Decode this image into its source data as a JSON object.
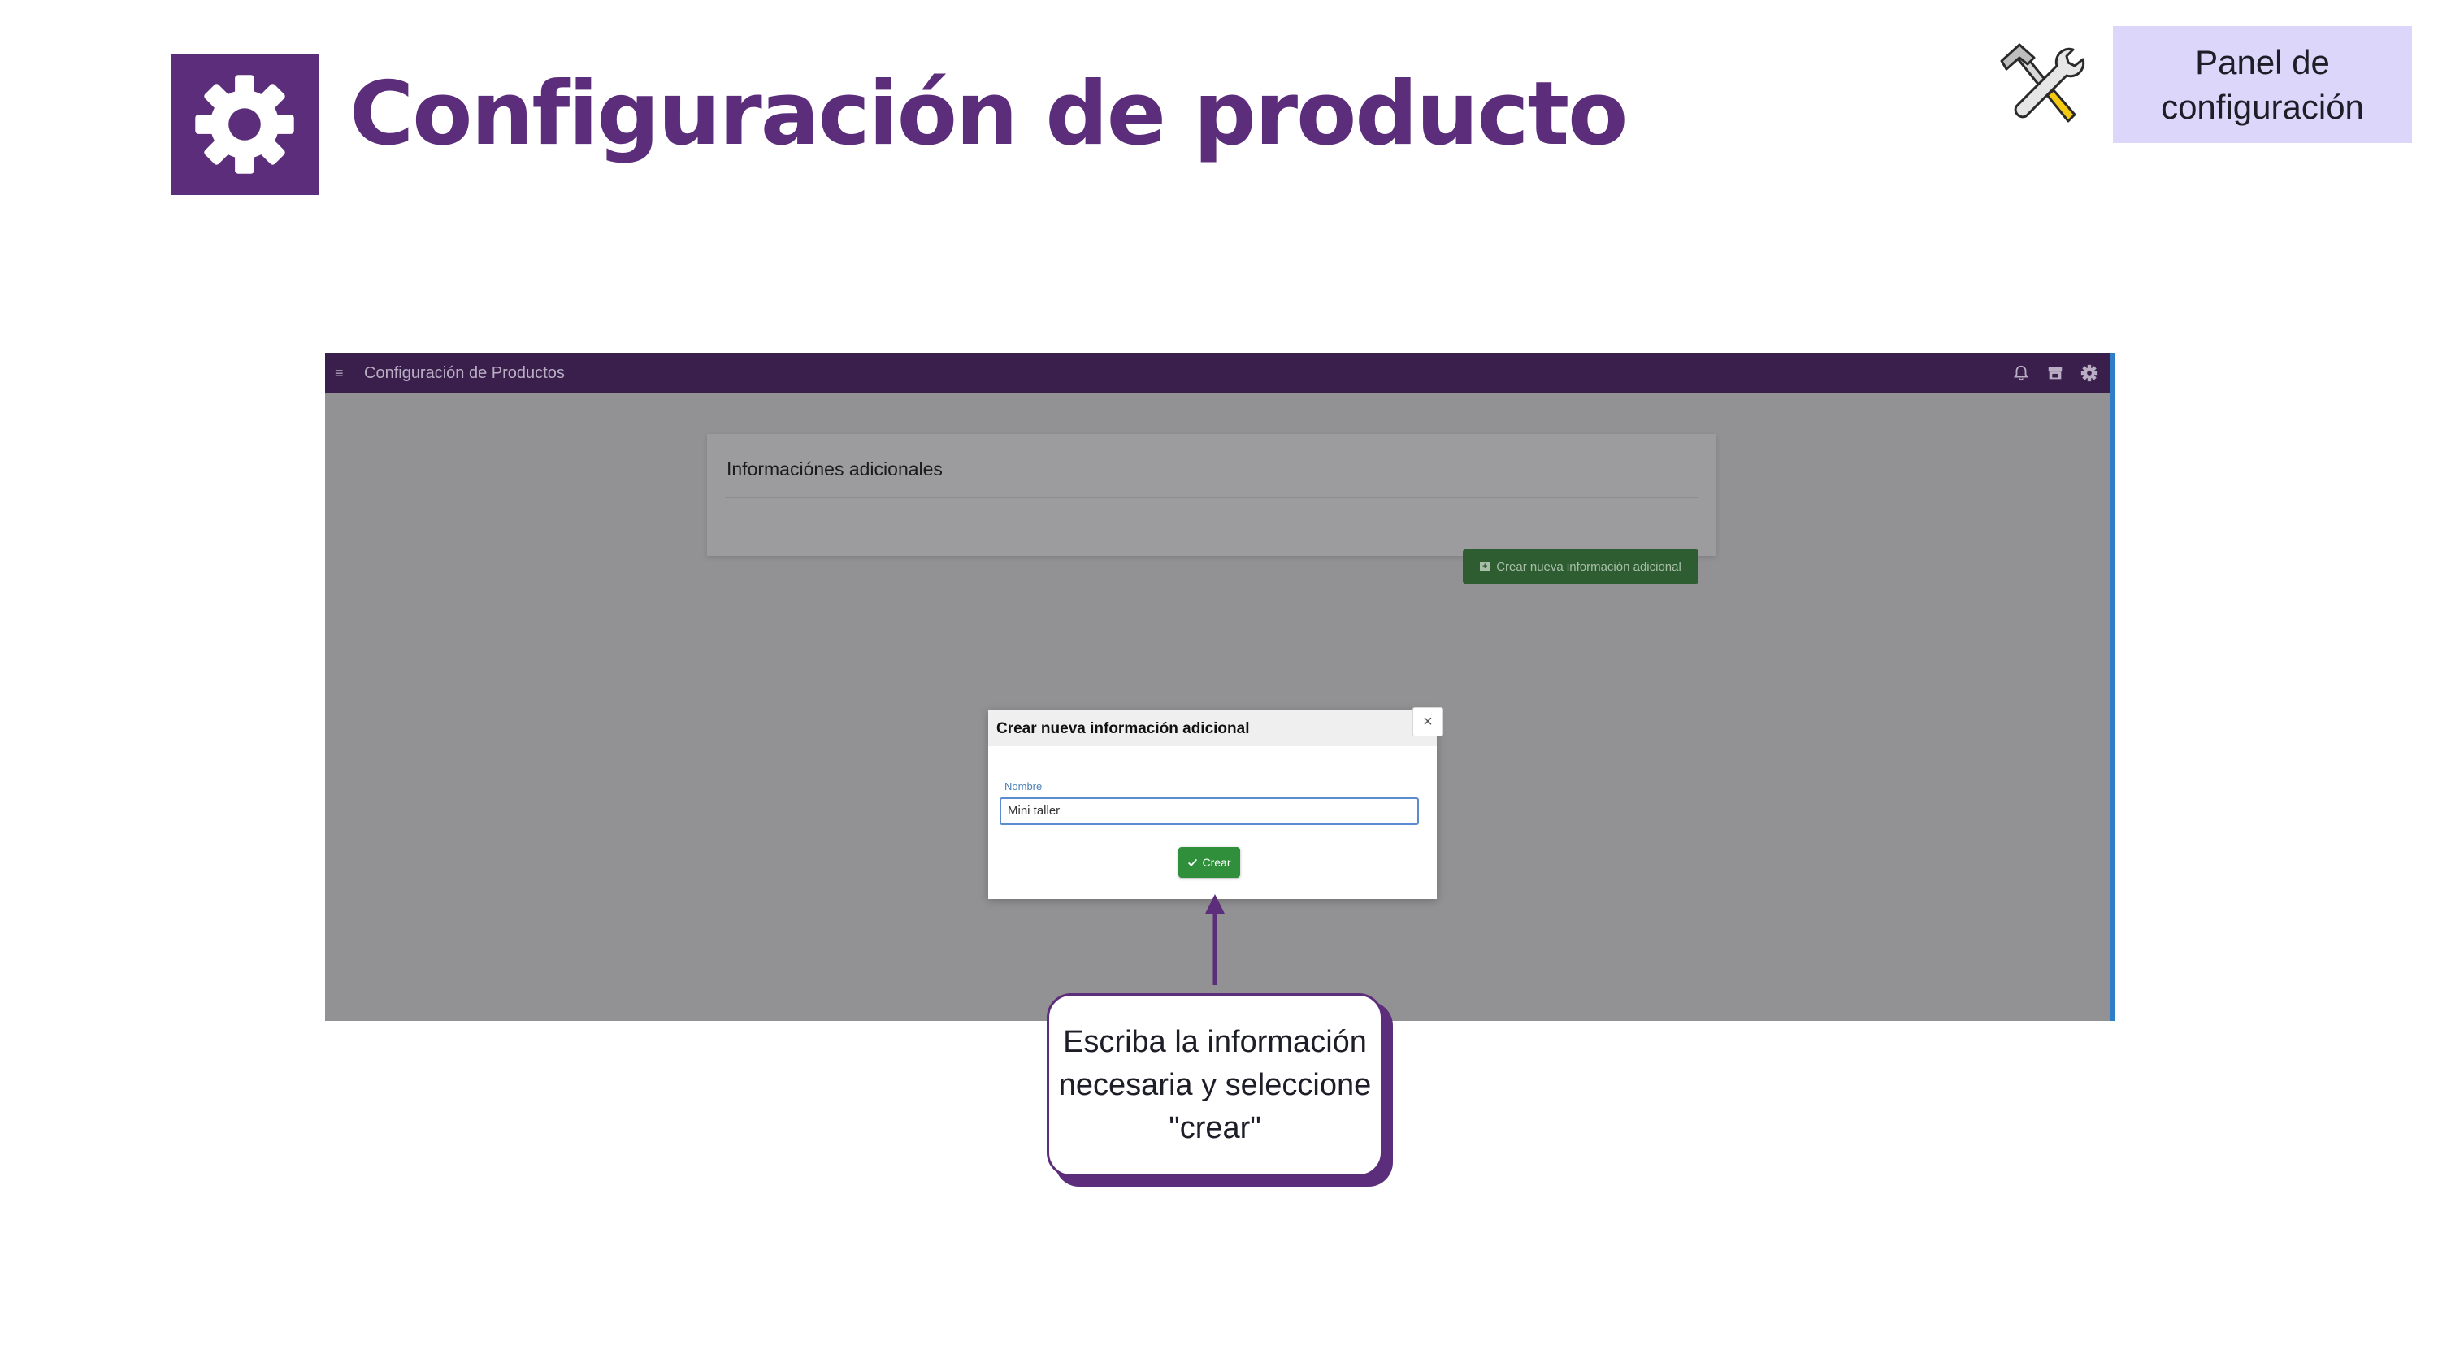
{
  "slide": {
    "title": "Configuración de producto",
    "badge": "Panel de configuración",
    "callout": "Escriba la información necesaria y seleccione \"crear\""
  },
  "app": {
    "header_title": "Configuración de Productos",
    "card_title": "Informaciónes adicionales",
    "create_info_button": "Crear nueva información adicional"
  },
  "modal": {
    "title": "Crear nueva información adicional",
    "close_symbol": "×",
    "field_label": "Nombre",
    "field_value": "Mini taller",
    "create_button": "Crear"
  },
  "colors": {
    "brand_purple": "#5b2d7a",
    "topbar": "#3a1f4c",
    "badge_bg": "#dcd6fa",
    "success_green": "#2f8f3a"
  },
  "icons": [
    "gear-icon",
    "tools-icon",
    "menu-icon",
    "bell-icon",
    "store-icon",
    "settings-icon",
    "plus-square-icon",
    "check-icon",
    "close-icon",
    "arrow-up-icon"
  ]
}
